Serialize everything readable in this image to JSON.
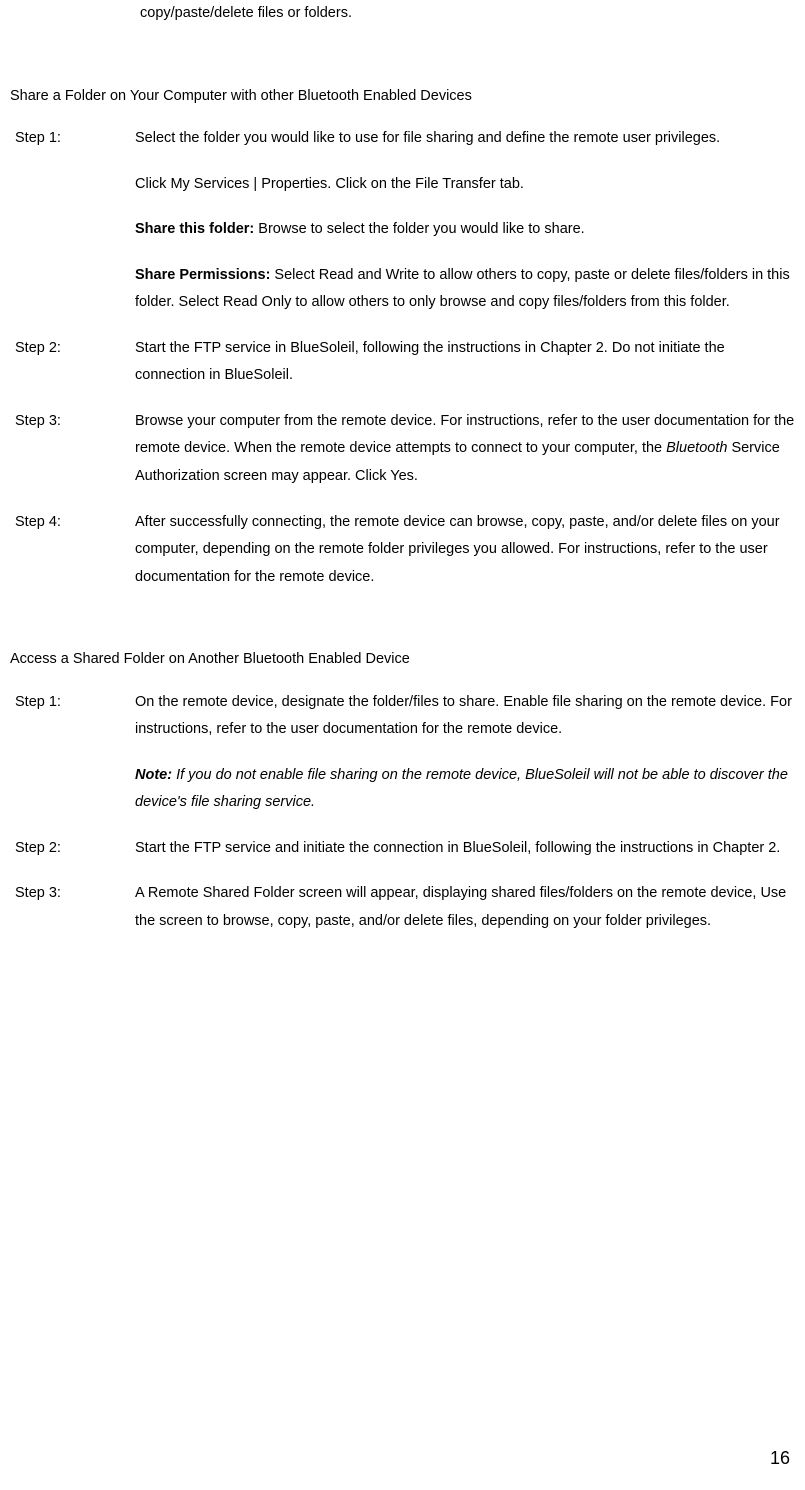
{
  "topFragment": "copy/paste/delete files or folders.",
  "section1": {
    "heading": "Share a Folder on Your Computer with other Bluetooth Enabled Devices",
    "steps": [
      {
        "label": "Step 1:",
        "body1": "Select the folder you would like to use for file sharing and define the remote user privileges.",
        "body2": "Click My Services | Properties. Click on the File Transfer tab.",
        "body3_bold": "Share this folder:",
        "body3_rest": " Browse to select the folder you would like to share.",
        "body4_bold": "Share Permissions:",
        "body4_rest": " Select Read and Write to allow others to copy, paste or delete files/folders in this folder. Select Read Only to allow others to only browse and copy files/folders from this folder."
      },
      {
        "label": "Step 2:",
        "body1": "Start the FTP service in BlueSoleil, following the instructions in Chapter 2. Do not initiate the connection in BlueSoleil."
      },
      {
        "label": "Step 3:",
        "body1_a": "Browse your computer from the remote device. For instructions, refer to the user documentation for the remote device. When the remote device attempts to connect to your computer, the ",
        "body1_italic": "Bluetooth",
        "body1_b": " Service Authorization screen may appear. Click Yes."
      },
      {
        "label": "Step 4:",
        "body1": "After successfully connecting, the remote device can browse, copy, paste, and/or delete files on your computer, depending on the remote folder privileges you allowed. For instructions, refer to the user documentation for the remote device."
      }
    ]
  },
  "section2": {
    "heading": "Access a Shared Folder on Another Bluetooth Enabled Device",
    "steps": [
      {
        "label": "Step 1:",
        "body1": "On the remote device, designate the folder/files to share. Enable file sharing on the remote device. For instructions, refer to the user documentation for the remote device.",
        "note_bold": "Note:",
        "note_rest": " If you do not enable file sharing on the remote device, BlueSoleil will not be able to discover the device's file sharing service."
      },
      {
        "label": "Step 2:",
        "body1": "Start the FTP service and initiate the connection in BlueSoleil, following the instructions in Chapter 2."
      },
      {
        "label": "Step 3:",
        "body1": "A Remote Shared Folder screen will appear, displaying shared files/folders on the remote device, Use the screen to browse, copy, paste, and/or delete files, depending on your folder privileges."
      }
    ]
  },
  "pageNumber": "16"
}
